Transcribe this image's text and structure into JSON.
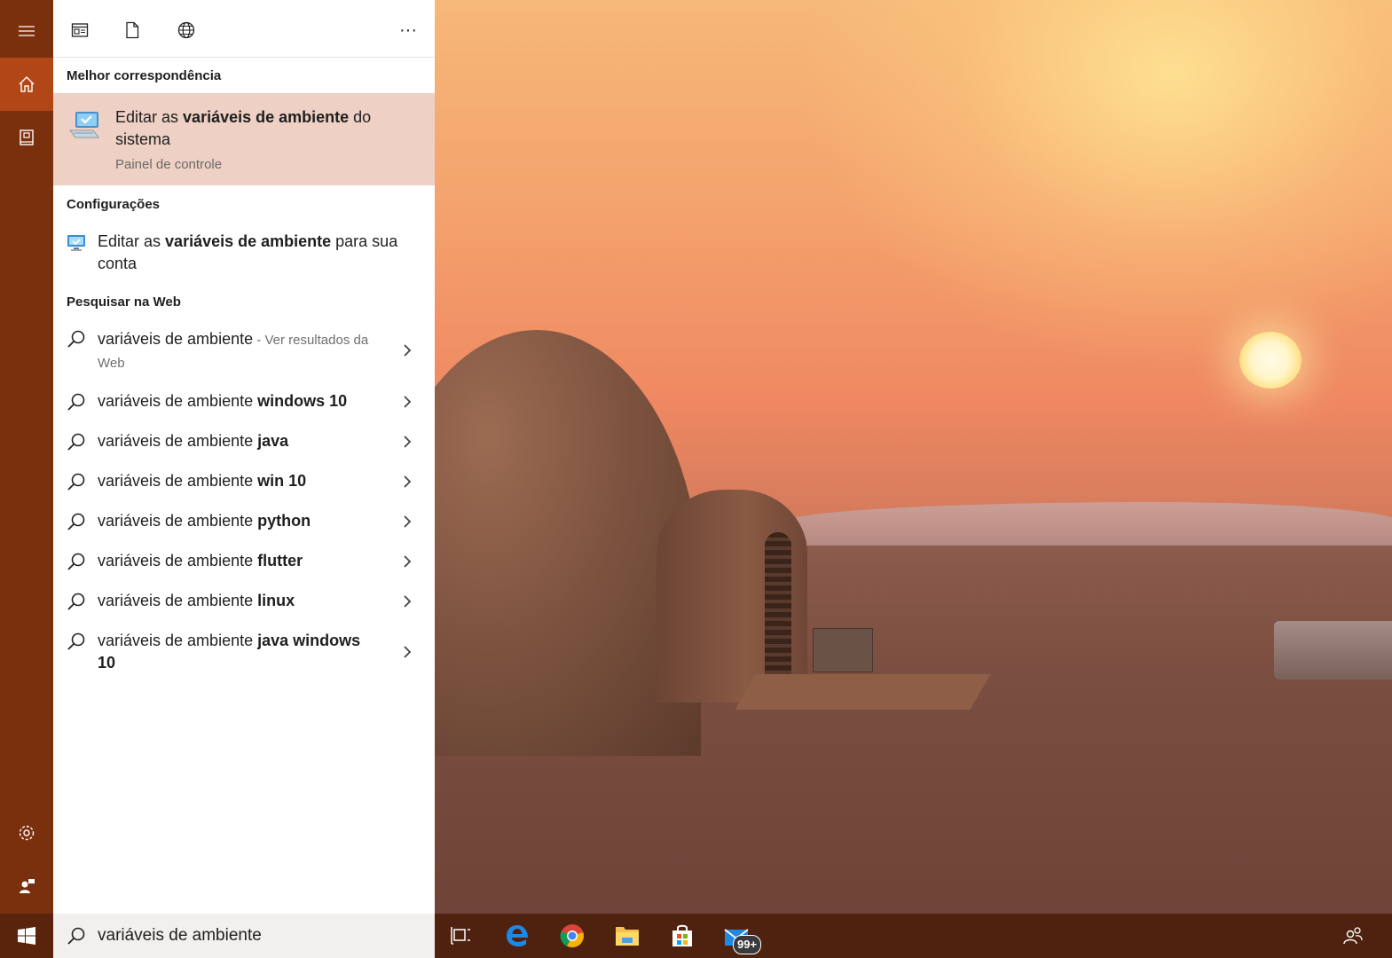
{
  "desktop": {
    "wallpaper": "desert-sunset-dome"
  },
  "rail": {
    "menu_icon": "hamburger-icon",
    "home_icon": "home-icon",
    "notebook_icon": "notebook-icon",
    "settings_icon": "gear-icon",
    "feedback_icon": "feedback-icon",
    "accent": "#7a2f0d",
    "selected": "#b14616"
  },
  "toolbar": {
    "apps_icon": "apps-filter-icon",
    "documents_icon": "document-filter-icon",
    "web_icon": "web-filter-icon",
    "more_label": "···"
  },
  "best_match": {
    "heading": "Melhor correspondência",
    "title_prefix": "Editar as ",
    "title_bold": "variáveis de ambiente",
    "title_suffix": " do sistema",
    "subtitle": "Painel de controle",
    "highlight": "#eed0c4"
  },
  "settings_section": {
    "heading": "Configurações",
    "item_prefix": "Editar as ",
    "item_bold": "variáveis de ambiente",
    "item_suffix": " para sua conta"
  },
  "web_section": {
    "heading": "Pesquisar na Web",
    "first": {
      "text": "variáveis de ambiente",
      "hint": " - Ver resultados da Web"
    },
    "suggestions": [
      {
        "base": "variáveis de ambiente ",
        "bold": "windows 10"
      },
      {
        "base": "variáveis de ambiente ",
        "bold": "java"
      },
      {
        "base": "variáveis de ambiente ",
        "bold": "win 10"
      },
      {
        "base": "variáveis de ambiente ",
        "bold": "python"
      },
      {
        "base": "variáveis de ambiente ",
        "bold": "flutter"
      },
      {
        "base": "variáveis de ambiente ",
        "bold": "linux"
      },
      {
        "base": "variáveis de ambiente ",
        "bold": "java windows 10"
      }
    ]
  },
  "search": {
    "value": "variáveis de ambiente"
  },
  "taskbar": {
    "icons": [
      "task-view-icon",
      "edge-icon",
      "chrome-icon",
      "file-explorer-icon",
      "store-icon",
      "mail-icon"
    ],
    "mail_badge": "99+",
    "people_icon": "people-icon"
  }
}
